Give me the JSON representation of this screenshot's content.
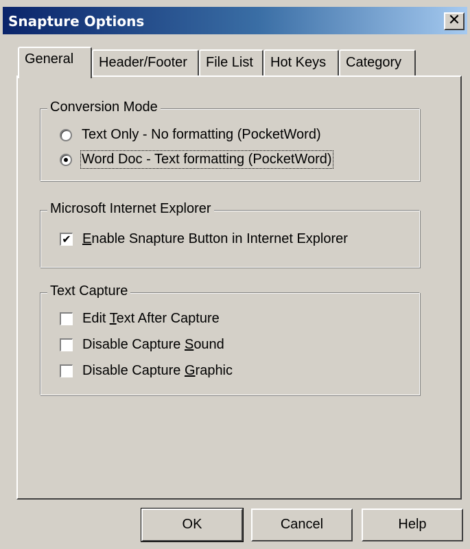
{
  "window": {
    "title": "Snapture Options",
    "close_glyph": "✕"
  },
  "tabs": [
    {
      "label": "General",
      "active": true
    },
    {
      "label": "Header/Footer",
      "active": false
    },
    {
      "label": "File List",
      "active": false
    },
    {
      "label": "Hot Keys",
      "active": false
    },
    {
      "label": "Category",
      "active": false
    }
  ],
  "conversion_mode": {
    "label": "Conversion Mode",
    "options": [
      {
        "label": "Text Only - No formatting (PocketWord)",
        "selected": false
      },
      {
        "label": "Word Doc - Text formatting (PocketWord)",
        "selected": true
      }
    ]
  },
  "internet_explorer": {
    "label": "Microsoft Internet Explorer",
    "enable_label_mnemonic": "E",
    "enable_label_rest": "nable Snapture Button in Internet Explorer",
    "enable_checked": true
  },
  "text_capture": {
    "label": "Text Capture",
    "items": [
      {
        "pre": "Edit ",
        "mnemonic": "T",
        "post": "ext After Capture",
        "checked": false
      },
      {
        "pre": "Disable Capture ",
        "mnemonic": "S",
        "post": "ound",
        "checked": false
      },
      {
        "pre": "Disable Capture ",
        "mnemonic": "G",
        "post": "raphic",
        "checked": false
      }
    ]
  },
  "buttons": {
    "ok": "OK",
    "cancel": "Cancel",
    "help": "Help"
  },
  "icons": {
    "check_glyph": "✔",
    "close": "close-icon"
  }
}
